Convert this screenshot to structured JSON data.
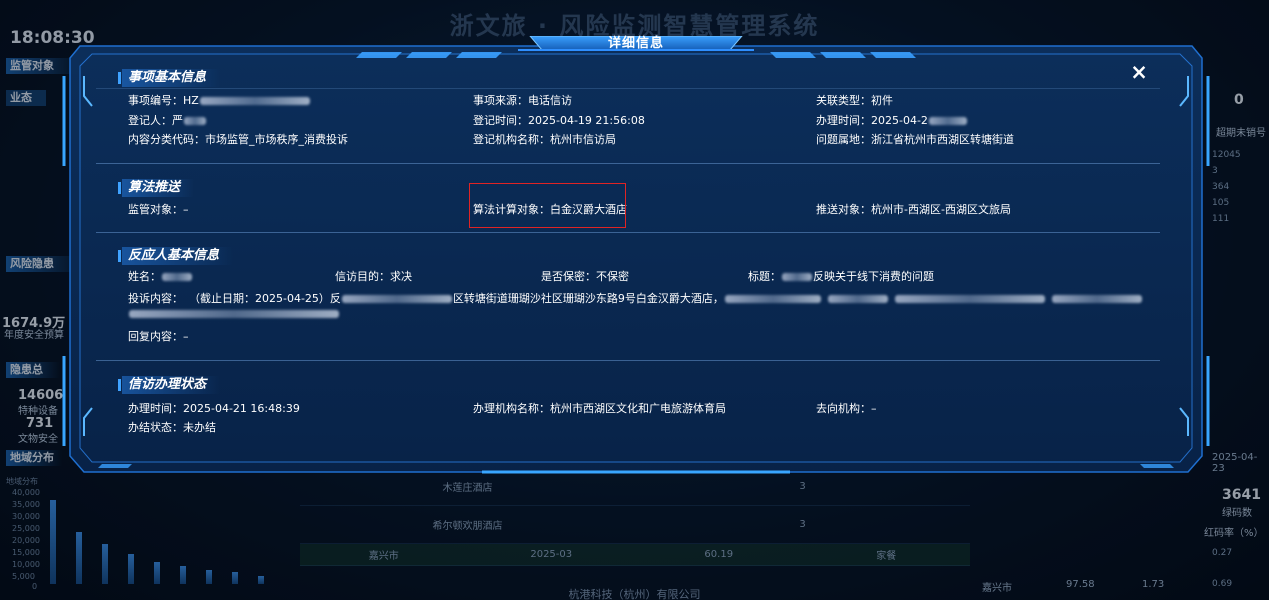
{
  "background": {
    "app_title": "浙文旅 · 风险监测智慧管理系统",
    "clock": "18:08:30",
    "left_panels": [
      "监管对象",
      "业态",
      "风险隐患",
      "隐患总",
      "地域分布"
    ],
    "left_values": [
      {
        "value": "1674.9万",
        "label": "年度安全预算"
      },
      {
        "value": "14606",
        "label": "特种设备"
      },
      {
        "value": "731",
        "label": "文物安全"
      }
    ],
    "chart_axis": [
      "40,000",
      "35,000",
      "30,000",
      "25,000",
      "20,000",
      "15,000",
      "10,000",
      "5,000",
      "0"
    ],
    "chart_title": "地域分布",
    "right_values": [
      {
        "value": "0",
        "label": "超期未销号"
      },
      {
        "value": "3641",
        "label": "绿码数"
      },
      {
        "value": "红码率（%）",
        "label": ""
      }
    ],
    "right_numbers": [
      "12045",
      "3",
      "364",
      "105",
      "111",
      "0.27",
      "0.69"
    ],
    "right_date": "2025-04-23",
    "table_rows": [
      {
        "name": "木莲庄酒店",
        "count": "3"
      },
      {
        "name": "希尔顿欢朋酒店",
        "count": "3"
      }
    ],
    "bottom_row": [
      "嘉兴市",
      "2025-03",
      "60.19",
      "家餐"
    ],
    "bottom_right_row": [
      "嘉兴市",
      "97.58",
      "1.73"
    ],
    "footer": "杭港科技（杭州）有限公司"
  },
  "modal": {
    "title": "详细信息",
    "close": "×",
    "sections": {
      "basic": {
        "title": "事项基本信息",
        "fields": {
          "item_no": {
            "label": "事项编号：",
            "value": "HZ"
          },
          "source": {
            "label": "事项来源：",
            "value": "电话信访"
          },
          "relation": {
            "label": "关联类型：",
            "value": "初件"
          },
          "registrant": {
            "label": "登记人：",
            "value": "严"
          },
          "reg_time": {
            "label": "登记时间：",
            "value": "2025-04-19 21:56:08"
          },
          "handle_time": {
            "label": "办理时间：",
            "value": "2025-04-2"
          },
          "category": {
            "label": "内容分类代码：",
            "value": "市场监管_市场秩序_消费投诉"
          },
          "reg_org": {
            "label": "登记机构名称：",
            "value": "杭州市信访局"
          },
          "location": {
            "label": "问题属地：",
            "value": "浙江省杭州市西湖区转塘街道"
          }
        }
      },
      "algo": {
        "title": "算法推送",
        "fields": {
          "target": {
            "label": "监管对象：",
            "value": "–"
          },
          "calc_target": {
            "label": "算法计算对象：",
            "value": "白金汉爵大酒店"
          },
          "push_target": {
            "label": "推送对象：",
            "value": "杭州市-西湖区-西湖区文旅局"
          }
        }
      },
      "reporter": {
        "title": "反应人基本信息",
        "fields": {
          "name": {
            "label": "姓名：",
            "value": ""
          },
          "purpose": {
            "label": "信访目的：",
            "value": "求决"
          },
          "secret": {
            "label": "是否保密：",
            "value": "不保密"
          },
          "subject": {
            "label": "标题：",
            "value": "反映关于线下消费的问题"
          },
          "content": {
            "label": "投诉内容：",
            "value_start": "（截止日期：2025-04-25）反",
            "value_mid": "区转塘街道珊瑚沙社区珊瑚沙东路9号白金汉爵大酒店，"
          },
          "reply": {
            "label": "回复内容：",
            "value": "–"
          }
        }
      },
      "status": {
        "title": "信访办理状态",
        "fields": {
          "time": {
            "label": "办理时间：",
            "value": "2025-04-21 16:48:39"
          },
          "org": {
            "label": "办理机构名称：",
            "value": "杭州市西湖区文化和广电旅游体育局"
          },
          "dest": {
            "label": "去向机构：",
            "value": "–"
          },
          "state": {
            "label": "办结状态：",
            "value": "未办结"
          }
        }
      }
    }
  },
  "colors": {
    "accent": "#3fa2ff",
    "frame": "#2f8fff",
    "highlight": "#e02424",
    "text": "#ffffff"
  }
}
